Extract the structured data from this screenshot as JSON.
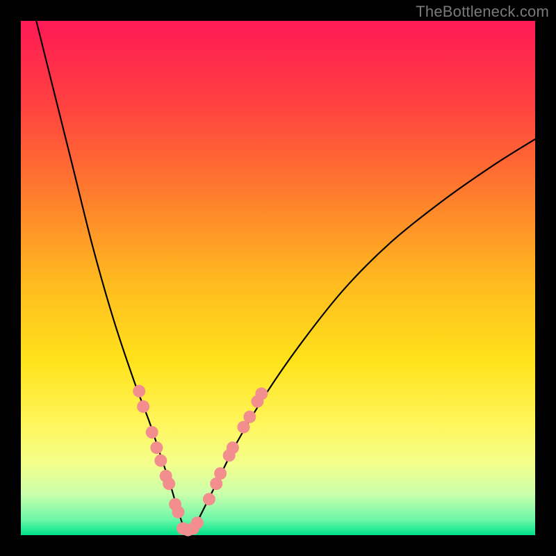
{
  "watermark": "TheBottleneck.com",
  "gradient": {
    "stops": [
      {
        "pos": 0.0,
        "color": "#ff1a55"
      },
      {
        "pos": 0.16,
        "color": "#ff4040"
      },
      {
        "pos": 0.33,
        "color": "#ff7a2e"
      },
      {
        "pos": 0.5,
        "color": "#ffb820"
      },
      {
        "pos": 0.66,
        "color": "#ffe21a"
      },
      {
        "pos": 0.78,
        "color": "#fff55a"
      },
      {
        "pos": 0.86,
        "color": "#f4ff8c"
      },
      {
        "pos": 0.92,
        "color": "#caffab"
      },
      {
        "pos": 0.97,
        "color": "#6cf7a8"
      },
      {
        "pos": 1.0,
        "color": "#00e28a"
      }
    ]
  },
  "chart_data": {
    "type": "line",
    "title": "",
    "xlabel": "",
    "ylabel": "",
    "xlim": [
      0,
      100
    ],
    "ylim": [
      0,
      100
    ],
    "series": [
      {
        "name": "bottleneck-curve",
        "x": [
          3,
          6,
          10,
          14,
          18,
          22,
          25,
          27,
          29,
          30.5,
          32,
          33.5,
          35,
          38,
          42,
          48,
          55,
          63,
          72,
          82,
          92,
          100
        ],
        "y": [
          100,
          88,
          72,
          56,
          42,
          30,
          22,
          16,
          10,
          5,
          1,
          1,
          4,
          10,
          18,
          28,
          38,
          48,
          57,
          65,
          72,
          77
        ]
      }
    ],
    "markers": [
      {
        "name": "left-cluster",
        "x": 23.0,
        "y": 28
      },
      {
        "name": "left-cluster",
        "x": 23.8,
        "y": 25
      },
      {
        "name": "left-cluster",
        "x": 25.5,
        "y": 20
      },
      {
        "name": "left-cluster",
        "x": 26.4,
        "y": 17
      },
      {
        "name": "left-cluster",
        "x": 27.2,
        "y": 14.5
      },
      {
        "name": "left-cluster",
        "x": 28.2,
        "y": 11.5
      },
      {
        "name": "left-cluster",
        "x": 28.8,
        "y": 10
      },
      {
        "name": "left-cluster",
        "x": 30.0,
        "y": 6
      },
      {
        "name": "left-cluster",
        "x": 30.6,
        "y": 4.5
      },
      {
        "name": "bottom",
        "x": 31.5,
        "y": 1.3
      },
      {
        "name": "bottom",
        "x": 32.5,
        "y": 1.0
      },
      {
        "name": "bottom",
        "x": 33.5,
        "y": 1.3
      },
      {
        "name": "bottom",
        "x": 34.3,
        "y": 2.4
      },
      {
        "name": "right-cluster",
        "x": 36.6,
        "y": 7
      },
      {
        "name": "right-cluster",
        "x": 38.0,
        "y": 10
      },
      {
        "name": "right-cluster",
        "x": 38.8,
        "y": 12
      },
      {
        "name": "right-cluster",
        "x": 40.5,
        "y": 15.5
      },
      {
        "name": "right-cluster",
        "x": 41.2,
        "y": 17
      },
      {
        "name": "right-cluster",
        "x": 43.3,
        "y": 21
      },
      {
        "name": "right-cluster",
        "x": 44.5,
        "y": 23
      },
      {
        "name": "right-cluster",
        "x": 46.0,
        "y": 26
      },
      {
        "name": "right-cluster",
        "x": 46.8,
        "y": 27.5
      }
    ],
    "marker_style": {
      "radius_px": 9,
      "fill": "#f28e8e"
    }
  }
}
